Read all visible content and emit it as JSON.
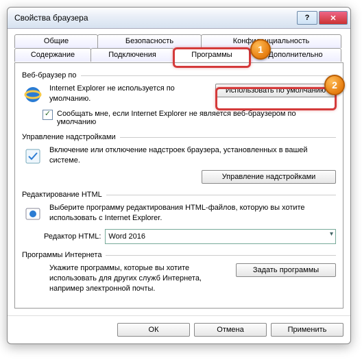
{
  "title": "Свойства браузера",
  "tabs": {
    "r1": [
      "Общие",
      "Безопасность",
      "Конфиденциальность"
    ],
    "r2": [
      "Содержание",
      "Подключения",
      "Программы",
      "Дополнительно"
    ],
    "active": "Программы"
  },
  "groups": {
    "browser": {
      "title": "Веб-браузер по",
      "msg": "Internet Explorer не используется по умолчанию.",
      "btn": "Использовать по умолчанию",
      "cb": "Сообщать мне, если Internet Explorer не является веб-браузером по умолчанию",
      "checked": "✓"
    },
    "addons": {
      "title": "Управление надстройками",
      "msg": "Включение или отключение надстроек браузера, установленных в вашей системе.",
      "btn": "Управление надстройками"
    },
    "html": {
      "title": "Редактирование HTML",
      "msg": "Выберите программу редактирования HTML-файлов, которую вы хотите использовать с Internet Explorer.",
      "label": "Редактор HTML:",
      "value": "Word 2016"
    },
    "programs": {
      "title": "Программы Интернета",
      "msg": "Укажите программы, которые вы хотите использовать для других служб Интернета, например электронной почты.",
      "btn": "Задать программы"
    }
  },
  "footer": {
    "ok": "ОК",
    "cancel": "Отмена",
    "apply": "Применить"
  },
  "marker1": "1",
  "marker2": "2"
}
